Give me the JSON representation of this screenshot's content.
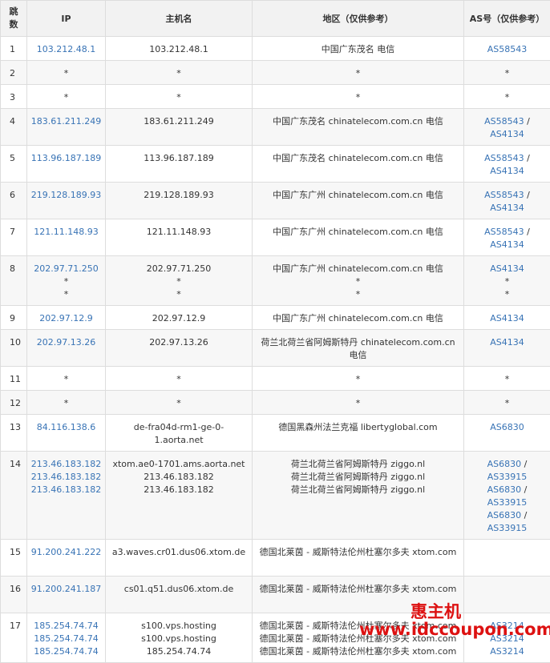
{
  "headers": {
    "hop": "跳数",
    "ip": "IP",
    "hostname": "主机名",
    "region": "地区（仅供参考）",
    "asn": "AS号（仅供参考）"
  },
  "rows": [
    {
      "hop": "1",
      "ips": [
        "103.212.48.1"
      ],
      "hosts": [
        "103.212.48.1"
      ],
      "regions": [
        "中国广东茂名 电信"
      ],
      "asns": [
        "AS58543"
      ]
    },
    {
      "hop": "2",
      "ips": [
        "*"
      ],
      "hosts": [
        "*"
      ],
      "regions": [
        "*"
      ],
      "asns": [
        "*"
      ]
    },
    {
      "hop": "3",
      "ips": [
        "*"
      ],
      "hosts": [
        "*"
      ],
      "regions": [
        "*"
      ],
      "asns": [
        "*"
      ]
    },
    {
      "hop": "4",
      "ips": [
        "183.61.211.249"
      ],
      "hosts": [
        "183.61.211.249"
      ],
      "regions": [
        "中国广东茂名 chinatelecom.com.cn 电信"
      ],
      "asns": [
        "AS58543 /",
        "AS4134"
      ]
    },
    {
      "hop": "5",
      "ips": [
        "113.96.187.189"
      ],
      "hosts": [
        "113.96.187.189"
      ],
      "regions": [
        "中国广东茂名 chinatelecom.com.cn 电信"
      ],
      "asns": [
        "AS58543 /",
        "AS4134"
      ]
    },
    {
      "hop": "6",
      "ips": [
        "219.128.189.93"
      ],
      "hosts": [
        "219.128.189.93"
      ],
      "regions": [
        "中国广东广州 chinatelecom.com.cn 电信"
      ],
      "asns": [
        "AS58543 /",
        "AS4134"
      ]
    },
    {
      "hop": "7",
      "ips": [
        "121.11.148.93"
      ],
      "hosts": [
        "121.11.148.93"
      ],
      "regions": [
        "中国广东广州 chinatelecom.com.cn 电信"
      ],
      "asns": [
        "AS58543 /",
        "AS4134"
      ]
    },
    {
      "hop": "8",
      "ips": [
        "202.97.71.250",
        "*",
        "*"
      ],
      "hosts": [
        "202.97.71.250",
        "*",
        "*"
      ],
      "regions": [
        "中国广东广州 chinatelecom.com.cn 电信",
        "*",
        "*"
      ],
      "asns": [
        "AS4134",
        "*",
        "*"
      ]
    },
    {
      "hop": "9",
      "ips": [
        "202.97.12.9"
      ],
      "hosts": [
        "202.97.12.9"
      ],
      "regions": [
        "中国广东广州 chinatelecom.com.cn 电信"
      ],
      "asns": [
        "AS4134"
      ]
    },
    {
      "hop": "10",
      "ips": [
        "202.97.13.26"
      ],
      "hosts": [
        "202.97.13.26"
      ],
      "regions": [
        "荷兰北荷兰省阿姆斯特丹 chinatelecom.com.cn",
        "电信"
      ],
      "asns": [
        "AS4134"
      ]
    },
    {
      "hop": "11",
      "ips": [
        "*"
      ],
      "hosts": [
        "*"
      ],
      "regions": [
        "*"
      ],
      "asns": [
        "*"
      ]
    },
    {
      "hop": "12",
      "ips": [
        "*"
      ],
      "hosts": [
        "*"
      ],
      "regions": [
        "*"
      ],
      "asns": [
        "*"
      ]
    },
    {
      "hop": "13",
      "ips": [
        "84.116.138.6"
      ],
      "hosts": [
        "de-fra04d-rm1-ge-0-",
        "1.aorta.net"
      ],
      "regions": [
        "德国黑森州法兰克福 libertyglobal.com"
      ],
      "asns": [
        "AS6830"
      ]
    },
    {
      "hop": "14",
      "ips": [
        "213.46.183.182",
        "213.46.183.182",
        "213.46.183.182"
      ],
      "hosts": [
        "xtom.ae0-1701.ams.aorta.net",
        "213.46.183.182",
        "213.46.183.182"
      ],
      "regions": [
        "荷兰北荷兰省阿姆斯特丹 ziggo.nl",
        "荷兰北荷兰省阿姆斯特丹 ziggo.nl",
        "荷兰北荷兰省阿姆斯特丹 ziggo.nl"
      ],
      "asns": [
        "AS6830 /",
        "AS33915",
        "AS6830 /",
        "AS33915",
        "AS6830 /",
        "AS33915"
      ]
    },
    {
      "hop": "15",
      "ips": [
        "91.200.241.222"
      ],
      "hosts": [
        "a3.waves.cr01.dus06.xtom.de"
      ],
      "regions": [
        "德国北莱茵 - 威斯特法伦州杜塞尔多夫 xtom.com"
      ],
      "asns": []
    },
    {
      "hop": "16",
      "ips": [
        "91.200.241.187"
      ],
      "hosts": [
        "cs01.q51.dus06.xtom.de"
      ],
      "regions": [
        "德国北莱茵 - 威斯特法伦州杜塞尔多夫 xtom.com"
      ],
      "asns": []
    },
    {
      "hop": "17",
      "ips": [
        "185.254.74.74",
        "185.254.74.74",
        "185.254.74.74"
      ],
      "hosts": [
        "s100.vps.hosting",
        "s100.vps.hosting",
        "185.254.74.74"
      ],
      "regions": [
        "德国北莱茵 - 威斯特法伦州杜塞尔多夫 xtom.com",
        "德国北莱茵 - 威斯特法伦州杜塞尔多夫 xtom.com",
        "德国北莱茵 - 威斯特法伦州杜塞尔多夫 xtom.com"
      ],
      "asns": [
        "AS3214",
        "AS3214",
        "AS3214"
      ]
    }
  ],
  "watermark": {
    "title": "惠主机",
    "url": "www.idccoupon.com"
  },
  "colors": {
    "link": "#3873b5",
    "watermark": "#dd1111",
    "header_bg": "#f2f2f2",
    "stripe_bg": "#f7f7f7",
    "border": "#dddddd"
  }
}
